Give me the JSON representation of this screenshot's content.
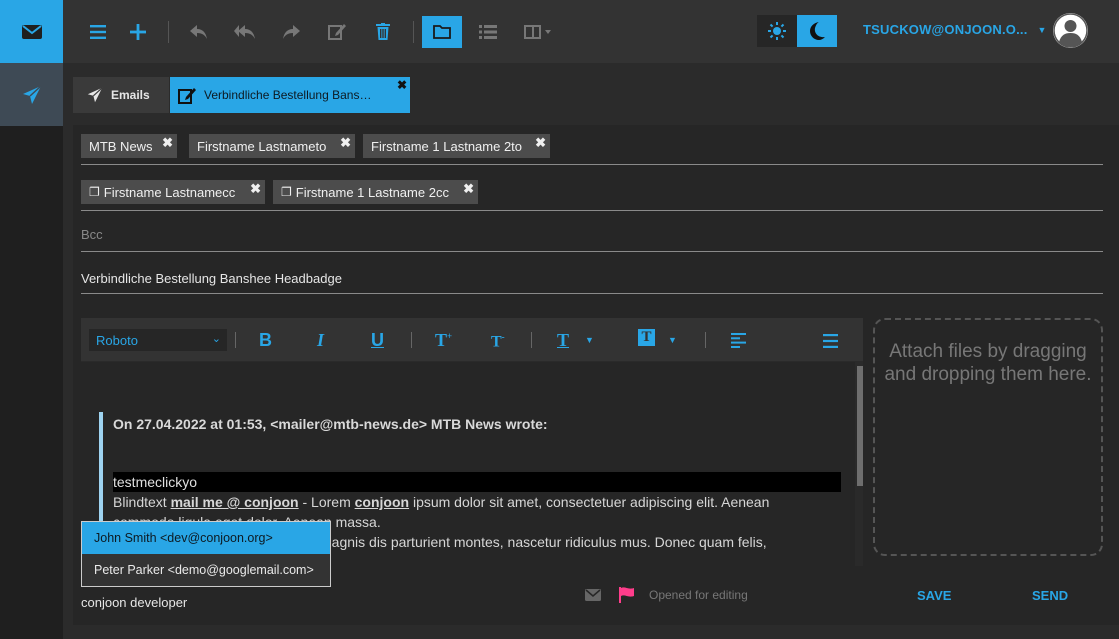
{
  "nav": {
    "mail_icon": "envelope-icon",
    "send_icon": "paper-plane-icon"
  },
  "toolbar": {
    "icons": [
      "menu-icon",
      "plus-icon",
      "reply-icon",
      "reply-all-icon",
      "forward-icon",
      "edit-icon",
      "trash-icon",
      "folder-icon",
      "list-icon",
      "columns-icon"
    ]
  },
  "user": {
    "label": "TSUCKOW@ONJOON.O..."
  },
  "tabs": {
    "emails_label": "Emails",
    "compose_label": "Verbindliche Bestellung Banshee ..."
  },
  "recipients": {
    "to": [
      "MTB News",
      "Firstname Lastnameto",
      "Firstname 1 Lastname 2to"
    ],
    "cc": [
      "Firstname Lastnamecc",
      "Firstname 1 Lastname 2cc"
    ],
    "bcc_placeholder": "Bcc"
  },
  "subject": "Verbindliche Bestellung Banshee Headbadge",
  "editor": {
    "font": "Roboto",
    "quote_header": "On 27.04.2022 at 01:53, <mailer@mtb-news.de> MTB News wrote:",
    "highlight_line": "testmeclickyo",
    "line1_prefix": "Blindtext ",
    "line1_link1": "mail me @ conjoon",
    "line1_mid": " - Lorem ",
    "line1_link2": "conjoon",
    "line1_suffix": " ipsum dolor sit amet, consectetuer adipiscing elit. Aenean",
    "line2": "commodo ligula eget dolor. Aenean massa.",
    "line3": "Cum sociis natoque penatibus et magnis dis parturient montes, nascetur ridiculus mus. Donec quam felis,"
  },
  "attachments": {
    "hint": "Attach files by dragging and dropping them here."
  },
  "footer": {
    "signature": "conjoon developer",
    "status": "Opened for editing",
    "save": "SAVE",
    "send": "SEND"
  },
  "autocomplete": [
    "John Smith <dev@conjoon.org>",
    "Peter Parker <demo@googlemail.com>"
  ],
  "colors": {
    "accent": "#29a6e6",
    "flag": "#ff3d8b"
  }
}
